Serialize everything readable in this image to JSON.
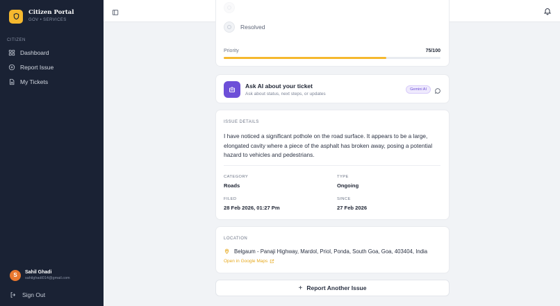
{
  "app": {
    "title": "Citizen Portal",
    "subtitle": "GOV • SERVICES",
    "accent_color": "#f5b82e",
    "sidebar_bg": "#1a2234"
  },
  "sidebar": {
    "section_label": "CITIZEN",
    "items": [
      {
        "label": "Dashboard",
        "icon": "grid-icon"
      },
      {
        "label": "Report Issue",
        "icon": "plus-circle-icon"
      },
      {
        "label": "My Tickets",
        "icon": "document-icon"
      }
    ],
    "user": {
      "initial": "S",
      "name": "Sahil Ghadi",
      "email": "sahilghadi014@gmail.com"
    },
    "signout_label": "Sign Out"
  },
  "status": {
    "steps": [
      {
        "label": "Resolved",
        "state": "pending"
      }
    ],
    "priority_label": "Priority",
    "priority_value": "75/100",
    "priority_fraction": 0.75
  },
  "ai": {
    "title": "Ask AI about your ticket",
    "subtitle": "Ask about status, next steps, or updates",
    "badge": "Gemini AI",
    "brand_color": "#6d4fd8"
  },
  "details": {
    "section_label": "ISSUE DETAILS",
    "description": "I have noticed a significant pothole on the road surface. It appears to be a large, elongated cavity where a piece of the asphalt has broken away, posing a potential hazard to vehicles and pedestrians.",
    "category_label": "CATEGORY",
    "category_value": "Roads",
    "type_label": "TYPE",
    "type_value": "Ongoing",
    "filed_label": "FILED",
    "filed_value": "28 Feb 2026, 01:27 Pm",
    "since_label": "SINCE",
    "since_value": "27 Feb 2026"
  },
  "location": {
    "section_label": "LOCATION",
    "address": "Belgaum - Panaji Highway, Mardol, Priol, Ponda, South Goa, Goa, 403404, India",
    "maps_link": "Open in Google Maps"
  },
  "actions": {
    "report_another": "Report Another Issue"
  }
}
